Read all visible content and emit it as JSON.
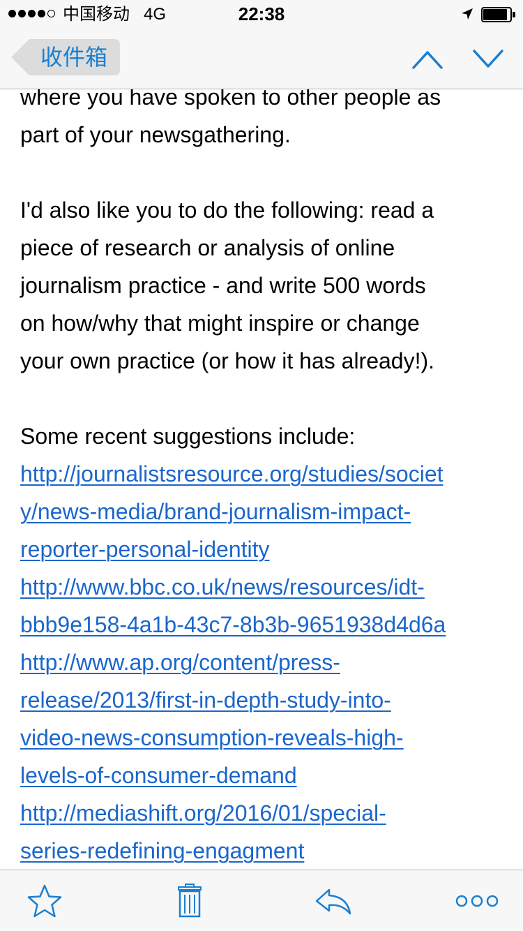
{
  "status_bar": {
    "carrier": "中国移动",
    "network": "4G",
    "time": "22:38",
    "battery_level": 0.9,
    "signal_bars_filled": 4,
    "signal_bars_total": 5
  },
  "nav": {
    "back_label": "收件箱",
    "accent_color": "#1a7fd0"
  },
  "message": {
    "para1": [
      "where you have spoken to other people as",
      "part of your newsgathering."
    ],
    "para2": [
      "I'd also like you to do the following: read a",
      "piece of research or analysis of online",
      "journalism practice - and write 500 words",
      "on how/why that might inspire or change",
      "your own practice (or how it has already!)."
    ],
    "suggestions_intro": "Some recent suggestions include:",
    "links": [
      [
        "http://journalistsresource.org/studies/societ",
        "y/news-media/brand-journalism-impact-",
        "reporter-personal-identity"
      ],
      [
        "http://www.bbc.co.uk/news/resources/idt-",
        "bbb9e158-4a1b-43c7-8b3b-9651938d4d6a"
      ],
      [
        "http://www.ap.org/content/press-",
        "release/2013/first-in-depth-study-into-",
        "video-news-consumption-reveals-high-",
        "levels-of-consumer-demand"
      ],
      [
        "http://mediashift.org/2016/01/special-",
        "series-redefining-engagment"
      ]
    ],
    "link_color": "#1a66cc"
  },
  "toolbar": {
    "icons": [
      "star-icon",
      "trash-icon",
      "reply-icon",
      "more-icon"
    ],
    "icon_color": "#1a7fd0"
  }
}
